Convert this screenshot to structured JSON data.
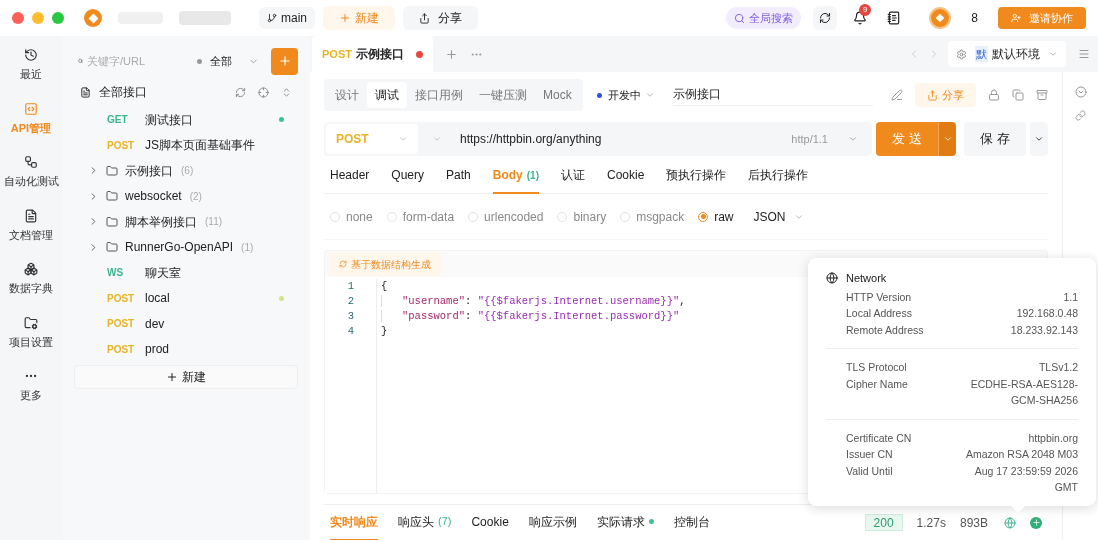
{
  "titlebar": {
    "branch": "main",
    "new_button": "新建",
    "share_button": "分享",
    "global_search": "全局搜索",
    "notification_count": "9",
    "member_count": "8",
    "invite_button": "邀请协作"
  },
  "rail": [
    {
      "label": "最近",
      "selected": false
    },
    {
      "label": "API管理",
      "selected": true
    },
    {
      "label": "自动化测试",
      "selected": false
    },
    {
      "label": "文档管理",
      "selected": false
    },
    {
      "label": "数据字典",
      "selected": false
    },
    {
      "label": "项目设置",
      "selected": false
    },
    {
      "label": "更多",
      "selected": false
    }
  ],
  "sidebar": {
    "search_placeholder": "关键字/URL",
    "filter": "全部",
    "root": "全部接口",
    "add_label": "新建",
    "items": [
      {
        "kind": "request",
        "method": "GET",
        "name": "测试接口",
        "color": "#3cc48f"
      },
      {
        "kind": "request",
        "method": "POST",
        "name": "JS脚本页面基础事件"
      },
      {
        "kind": "folder",
        "name": "示例接口",
        "count": "(6)"
      },
      {
        "kind": "folder",
        "name": "websocket",
        "count": "(2)"
      },
      {
        "kind": "folder",
        "name": "脚本举例接口",
        "count": "(11)"
      },
      {
        "kind": "folder",
        "name": "RunnerGo-OpenAPI",
        "count": "(1)"
      },
      {
        "kind": "request",
        "method": "WS",
        "name": "聊天室"
      },
      {
        "kind": "request",
        "method": "POST",
        "name": "local",
        "color": "#d4e28a"
      },
      {
        "kind": "request",
        "method": "POST",
        "name": "dev"
      },
      {
        "kind": "request",
        "method": "POST",
        "name": "prod"
      }
    ]
  },
  "tabs": [
    {
      "method": "POST",
      "name": "示例接口",
      "selected": true,
      "unsaved": true
    }
  ],
  "environment": {
    "badge": "默",
    "label": "默认环境"
  },
  "mode_tabs": [
    {
      "label": "设计",
      "selected": false
    },
    {
      "label": "调试",
      "selected": true
    },
    {
      "label": "接口用例",
      "selected": false
    },
    {
      "label": "一键压测",
      "selected": false
    },
    {
      "label": "Mock",
      "selected": false
    }
  ],
  "api_status": {
    "label": "开发中",
    "color": "#2b55d9"
  },
  "api_name": "示例接口",
  "share": "分享",
  "request": {
    "method": "POST",
    "url": "https://httpbin.org/anything",
    "protocol": "http/1.1",
    "send": "发 送",
    "save": "保 存"
  },
  "param_tabs": [
    {
      "label": "Header",
      "selected": false
    },
    {
      "label": "Query",
      "selected": false
    },
    {
      "label": "Path",
      "selected": false
    },
    {
      "label": "Body",
      "count": "(1)",
      "selected": true
    },
    {
      "label": "认证",
      "selected": false
    },
    {
      "label": "Cookie",
      "selected": false
    },
    {
      "label": "预执行操作",
      "selected": false
    },
    {
      "label": "后执行操作",
      "selected": false
    }
  ],
  "body_types": [
    {
      "label": "none",
      "selected": false
    },
    {
      "label": "form-data",
      "selected": false
    },
    {
      "label": "urlencoded",
      "selected": false
    },
    {
      "label": "binary",
      "selected": false
    },
    {
      "label": "msgpack",
      "selected": false
    },
    {
      "label": "raw",
      "selected": true
    }
  ],
  "body_format": "JSON",
  "generate_button": "基于数据结构生成",
  "code": [
    {
      "num": "1",
      "tokens": [
        {
          "kind": "punct",
          "text": "{"
        }
      ]
    },
    {
      "num": "2",
      "tokens": [
        {
          "kind": "key",
          "text": "\"username\""
        },
        {
          "kind": "punct",
          "text": ": "
        },
        {
          "kind": "string",
          "text": "\"{{$fakerjs.Internet.username}}\""
        },
        {
          "kind": "punct",
          "text": ","
        }
      ]
    },
    {
      "num": "3",
      "tokens": [
        {
          "kind": "key",
          "text": "\"password\""
        },
        {
          "kind": "punct",
          "text": ": "
        },
        {
          "kind": "string",
          "text": "\"{{$fakerjs.Internet.password}}\""
        }
      ]
    },
    {
      "num": "4",
      "tokens": [
        {
          "kind": "punct",
          "text": "}"
        }
      ]
    }
  ],
  "response_tabs": [
    {
      "label": "实时响应",
      "selected": true
    },
    {
      "label": "响应头",
      "count": "(7)",
      "selected": false
    },
    {
      "label": "Cookie",
      "selected": false
    },
    {
      "label": "响应示例",
      "selected": false
    },
    {
      "label": "实际请求",
      "dot": true,
      "selected": false
    },
    {
      "label": "控制台",
      "selected": false
    }
  ],
  "response_status": {
    "code": "200",
    "time": "1.27s",
    "size": "893B"
  },
  "network_popover": {
    "title": "Network",
    "sections": [
      [
        {
          "label": "HTTP Version",
          "value": "1.1"
        },
        {
          "label": "Local Address",
          "value": "192.168.0.48"
        },
        {
          "label": "Remote Address",
          "value": "18.233.92.143"
        }
      ],
      [
        {
          "label": "TLS Protocol",
          "value": "TLSv1.2"
        },
        {
          "label": "Cipher Name",
          "value": "ECDHE-RSA-AES128-GCM-SHA256"
        }
      ],
      [
        {
          "label": "Certificate CN",
          "value": "httpbin.org"
        },
        {
          "label": "Issuer CN",
          "value": "Amazon RSA 2048 M03"
        },
        {
          "label": "Valid Until",
          "value": "Aug 17 23:59:59 2026 GMT"
        }
      ]
    ]
  }
}
